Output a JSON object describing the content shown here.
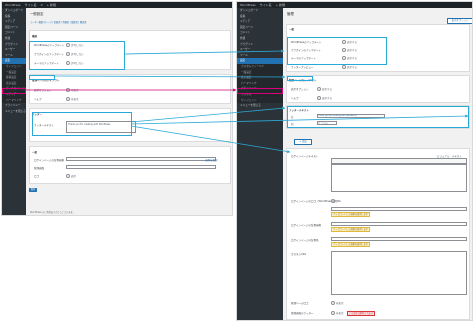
{
  "left": {
    "adminbar": [
      "WordPress",
      "サイト名",
      "0",
      "+ 新規"
    ],
    "sidebar": [
      "ダッシュボード",
      "投稿",
      "メディア",
      "固定ページ",
      "コメント",
      "外観",
      "プラグイン",
      "ユーザー",
      "ツール",
      "設定",
      "ウィジェット",
      "一般設定",
      "投稿設定",
      "表示設定",
      "ディスカッション",
      "メディア",
      "パーマリンク",
      "プライバシー",
      "メニューを閉じる"
    ],
    "page_title": "一般設定",
    "subnav": "ユーザー権限グループ | 投稿者 | 寄稿者 | 編集者 | 購読者",
    "section1": "権限",
    "rows1": [
      {
        "label": "WordPressのアップデート",
        "value": "許可しない"
      },
      {
        "label": "プラグインのアップデート",
        "value": "許可しない"
      },
      {
        "label": "テーマのアップデート",
        "value": "許可しない"
      }
    ],
    "section2": "管理ページのレイアウト",
    "rows2": [
      {
        "label": "表示オプション",
        "value": "非表示"
      },
      {
        "label": "ヘルプ",
        "value": "非表示"
      }
    ],
    "section3": "フッター",
    "rows3": [
      {
        "label": "テキスト",
        "value": ""
      },
      {
        "label": "フッターテキスト",
        "value": "Thank you for creating with WordPress."
      }
    ],
    "section4": "一般",
    "rows4": [
      {
        "label": "ログインページの背景画像",
        "value": "画像を選択"
      },
      {
        "label": "管理画面",
        "value": ""
      },
      {
        "label": "ロゴ",
        "value": "表示"
      }
    ],
    "save": "保存",
    "footer": "WordPress のご利用ありがとうございます。"
  },
  "right": {
    "adminbar": [
      "WordPress",
      "サイト名",
      "+ 新規"
    ],
    "sidebar": [
      "ダッシュボード",
      "投稿",
      "メディア",
      "固定ページ",
      "コメント",
      "外観",
      "プラグイン",
      "ユーザー",
      "ツール",
      "設定",
      "カスタムフィールド",
      "一般設定",
      "表示設定",
      "パーマリンク",
      "プライバシー",
      "カスタム",
      "ウィジェット",
      "メニューを閉じる"
    ],
    "page_title": "管理",
    "screen_options": "表示オプション",
    "section1": "一般",
    "rows1": [
      {
        "label": "WordPressのアップデート",
        "value": "表示する"
      },
      {
        "label": "プラグインのアップデート",
        "value": "表示する"
      },
      {
        "label": "テーマのアップデート",
        "value": "表示する"
      },
      {
        "label": "フッタープレビュー",
        "value": "表示する"
      }
    ],
    "section2": "管理ページのレイアウト",
    "rows2": [
      {
        "label": "表示オプション",
        "value": "表示する"
      },
      {
        "label": "ヘルプ",
        "value": "表示する"
      }
    ],
    "section3": "フッターテキスト",
    "rows3": [
      {
        "label": "左",
        "value": "Thank you for creating with WordPress."
      },
      {
        "label": "右",
        "value": "バージョン"
      }
    ],
    "add_button": "+ 追加",
    "editor": {
      "title": "ログインページテキスト",
      "tab_visual": "ビジュアル",
      "tab_text": "テキスト"
    },
    "rows4": [
      {
        "label": "ログインページのロゴ（WordPress公式）",
        "value": "URL"
      },
      {
        "label": "ログインページの背景画像",
        "value": ""
      },
      {
        "label": "ログインページの背景色",
        "value": ""
      },
      {
        "label": "カスタムCSS",
        "value": ""
      },
      {
        "label": "管理バーのロゴ",
        "value": "非表示"
      },
      {
        "label": "管理画面のフッター",
        "value": "非表示"
      }
    ],
    "warn1": "アップロードした画像を使用します",
    "warn2": "アップロードした画像を使用します",
    "warn3": "アップロードした画像を使用します",
    "error": "この設定は削除されます"
  },
  "colors": {
    "highlight": "#2aa9d6",
    "magenta": "#d6007a",
    "wp_blue": "#2271b1",
    "sidebar": "#2c3338"
  }
}
